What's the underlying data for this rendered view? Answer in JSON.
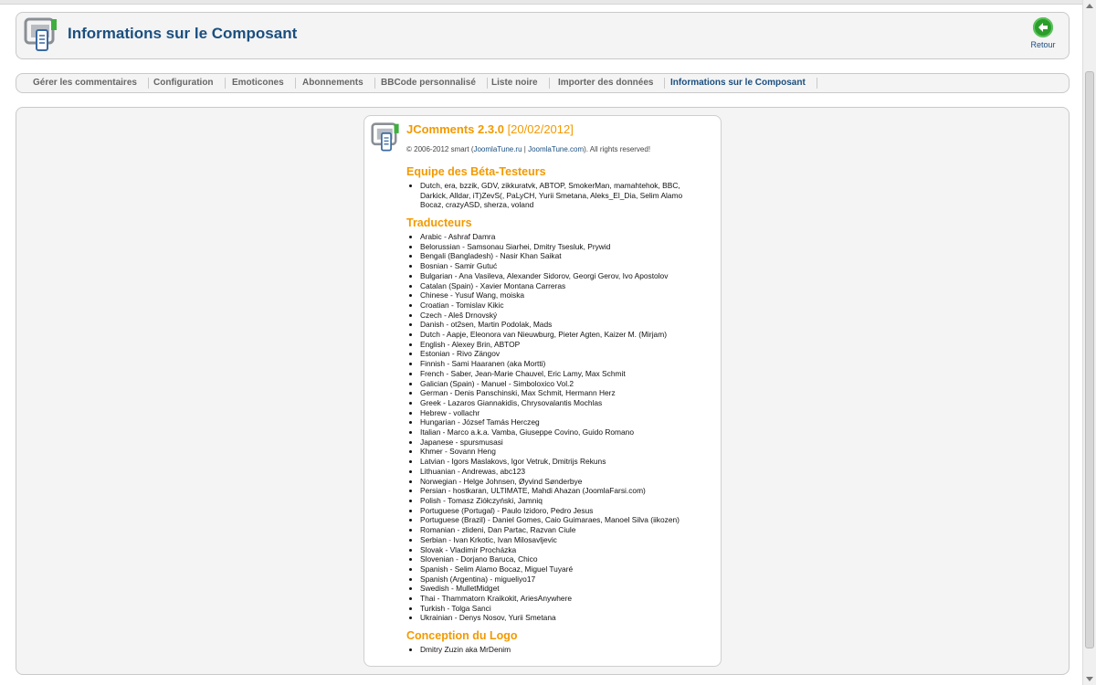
{
  "header": {
    "title": "Informations sur le Composant",
    "back_label": "Retour"
  },
  "tabs": [
    {
      "label": "Gérer les commentaires"
    },
    {
      "label": "Configuration"
    },
    {
      "label": "Emoticones"
    },
    {
      "label": "Abonnements"
    },
    {
      "label": "BBCode personnalisé"
    },
    {
      "label": "Liste noire"
    },
    {
      "label": "Importer des données"
    },
    {
      "label": "Informations sur le Composant"
    }
  ],
  "card": {
    "title_name": "JComments 2.3.0",
    "title_date": "[20/02/2012]",
    "copyright_prefix": "© 2006-2012 smart (",
    "link_ru": "JoomlaTune.ru",
    "sep": " | ",
    "link_com": "JoomlaTune.com",
    "copyright_suffix": "). All rights reserved!"
  },
  "beta": {
    "heading": "Equipe des Béta-Testeurs",
    "text": "Dutch, era, bzzik, GDV, zikkuratvk, ABTOP, SmokerMan, mamahtehok, BBC, Darkick, Alldar, iT)ZevS(, PaLyCH, Yurii Smetana, Aleks_El_Dia, Selim Alamo Bocaz, crazyASD, sherza, voland"
  },
  "translators": {
    "heading": "Traducteurs",
    "items": [
      "Arabic - Ashraf Damra",
      "Belorussian - Samsonau Siarhei, Dmitry Tsesluk, Prywid",
      "Bengali (Bangladesh) - Nasir Khan Saikat",
      "Bosnian - Samir Gutuć",
      "Bulgarian - Ana Vasileva, Alexander Sidorov, Georgi Gerov, Ivo Apostolov",
      "Catalan (Spain) - Xavier Montana Carreras",
      "Chinese - Yusuf Wang, moiska",
      "Croatian - Tomislav Kikic",
      "Czech - Aleš Drnovský",
      "Danish - ot2sen, Martin Podolak, Mads",
      "Dutch - Aapje, Eleonora van Nieuwburg, Pieter Agten, Kaizer M. (Mirjam)",
      "English - Alexey Brin, ABTOP",
      "Estonian - Rivo Zängov",
      "Finnish - Sami Haaranen (aka Mortti)",
      "French - Saber, Jean-Marie Chauvel, Eric Lamy, Max Schmit",
      "Galician (Spain) - Manuel - Simboloxico Vol.2",
      "German - Denis Panschinski, Max Schmit, Hermann Herz",
      "Greek - Lazaros Giannakidis, Chrysovalantis Mochlas",
      "Hebrew - vollachr",
      "Hungarian - József Tamás Herczeg",
      "Italian - Marco a.k.a. Vamba, Giuseppe Covino, Guido Romano",
      "Japanese - spursmusasi",
      "Khmer - Sovann Heng",
      "Latvian - Igors Maslakovs, Igor Vetruk, Dmitrijs Rekuns",
      "Lithuanian - Andrewas, abc123",
      "Norwegian - Helge Johnsen, Øyvind Sønderbye",
      "Persian - hostkaran, ULTIMATE, Mahdi Ahazan (JoomlaFarsi.com)",
      "Polish - Tomasz Ziółczyński, Jamniq",
      "Portuguese (Portugal) - Paulo Izidoro, Pedro Jesus",
      "Portuguese (Brazil) - Daniel Gomes, Caio Guimaraes, Manoel Silva (iikozen)",
      "Romanian - zlideni, Dan Partac, Razvan Ciule",
      "Serbian - Ivan Krkotic, Ivan Milosavljevic",
      "Slovak - Vladimír Procházka",
      "Slovenian - Dorjano Baruca, Chico",
      "Spanish - Selim Alamo Bocaz, Miguel Tuyaré",
      "Spanish (Argentina) - migueliyo17",
      "Swedish - MulletMidget",
      "Thai - Thammatorn Kraikokit, AriesAnywhere",
      "Turkish - Tolga Sanci",
      "Ukrainian - Denys Nosov, Yurii Smetana"
    ]
  },
  "logo": {
    "heading": "Conception du Logo",
    "items": [
      "Dmitry Zuzin aka MrDenim"
    ]
  },
  "colors": {
    "title": "#1b4f7f",
    "accent": "#f29a00",
    "back_green": "#2a9d2a"
  }
}
